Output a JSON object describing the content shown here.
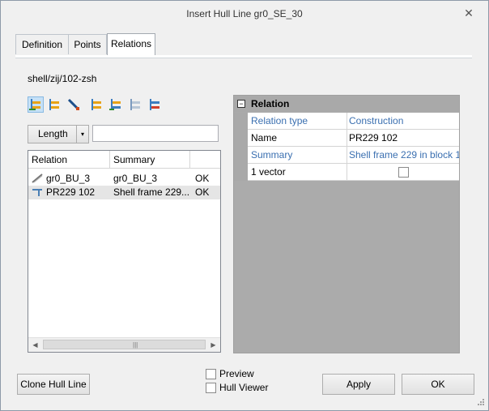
{
  "window": {
    "title": "Insert Hull Line gr0_SE_30",
    "close_glyph": "✕"
  },
  "tabs": [
    {
      "label": "Definition",
      "active": false
    },
    {
      "label": "Points",
      "active": false
    },
    {
      "label": "Relations",
      "active": true
    }
  ],
  "path_text": "shell/zij/102-zsh",
  "toolbar_icons": [
    "add-relation-icon",
    "tree-relation-icon",
    "edit-relation-icon",
    "tree-list-icon",
    "add-list-icon",
    "remove-list-icon",
    "delete-list-icon"
  ],
  "filter": {
    "combo_value": "Length",
    "combo_arrow": "▾",
    "input_value": ""
  },
  "relation_list": {
    "columns": [
      "Relation",
      "Summary",
      ""
    ],
    "rows": [
      {
        "relation": "gr0_BU_3",
        "summary": "gr0_BU_3",
        "status": "OK",
        "icon": "seam-icon"
      },
      {
        "relation": "PR229 102",
        "summary": "Shell frame 229...",
        "status": "OK",
        "icon": "frame-icon"
      }
    ],
    "scroll_left": "◀",
    "scroll_right": "▶",
    "grip": "|||"
  },
  "properties": {
    "header": "Relation",
    "expander": "−",
    "rows": [
      {
        "name": "Relation type",
        "value": "Construction",
        "blue": true
      },
      {
        "name": "Name",
        "value": "PR229 102",
        "blue": false
      },
      {
        "name": "Summary",
        "value": "Shell frame 229 in block 1",
        "blue": true
      },
      {
        "name": "1 vector",
        "value": "",
        "checkbox": true,
        "checked": false,
        "blue": false
      }
    ]
  },
  "buttons": {
    "clone": "Clone Hull Line",
    "apply": "Apply",
    "ok": "OK"
  },
  "options": {
    "preview": {
      "label": "Preview",
      "checked": false
    },
    "hull_viewer": {
      "label": "Hull Viewer",
      "checked": false
    }
  },
  "colors": {
    "accent_blue": "#3a6fb0",
    "grid_header": "#a9a9a9"
  }
}
